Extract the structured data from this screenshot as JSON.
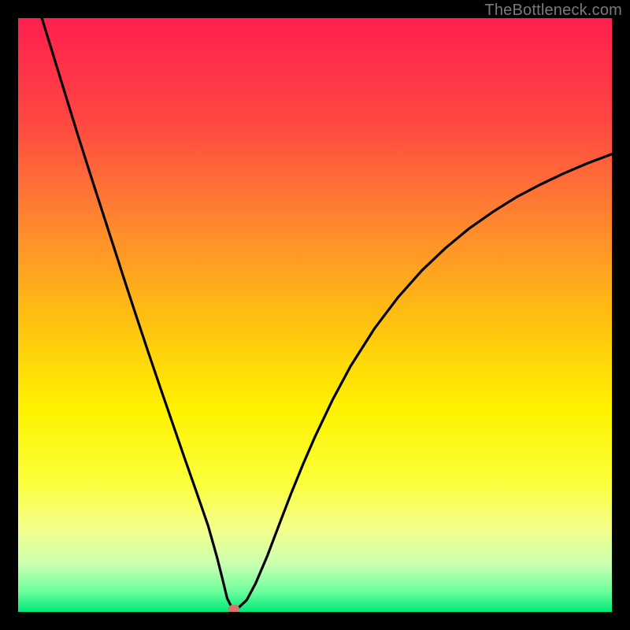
{
  "watermark": "TheBottleneck.com",
  "chart_data": {
    "type": "line",
    "title": "",
    "xlabel": "",
    "ylabel": "",
    "xlim": [
      0,
      100
    ],
    "ylim": [
      0,
      100
    ],
    "background_gradient_stops": [
      {
        "offset": 0.0,
        "color": "#ff1f4e"
      },
      {
        "offset": 0.17,
        "color": "#ff4642"
      },
      {
        "offset": 0.34,
        "color": "#ff8530"
      },
      {
        "offset": 0.5,
        "color": "#ffbe12"
      },
      {
        "offset": 0.66,
        "color": "#fff200"
      },
      {
        "offset": 0.78,
        "color": "#fbff3a"
      },
      {
        "offset": 0.86,
        "color": "#f4ff8a"
      },
      {
        "offset": 0.92,
        "color": "#caffb0"
      },
      {
        "offset": 0.965,
        "color": "#6eff9e"
      },
      {
        "offset": 1.0,
        "color": "#00e879"
      }
    ],
    "series": [
      {
        "name": "bottleneck-curve",
        "x": [
          4,
          6,
          8,
          10,
          12,
          14,
          16,
          18,
          20,
          22,
          24,
          26,
          28,
          30,
          32,
          33.5,
          34.5,
          35.2,
          36,
          37,
          38.5,
          40,
          42,
          44,
          46,
          48,
          50,
          53,
          56,
          60,
          64,
          68,
          72,
          76,
          80,
          84,
          88,
          92,
          96,
          100
        ],
        "y": [
          100,
          93.5,
          87,
          80.5,
          74.2,
          68,
          61.8,
          55.6,
          49.5,
          43.5,
          37.6,
          31.8,
          26,
          20.3,
          14.5,
          9.2,
          5.2,
          2.3,
          0.7,
          0.6,
          2.0,
          4.8,
          9.5,
          14.8,
          20.0,
          24.9,
          29.5,
          35.8,
          41.4,
          47.7,
          53.0,
          57.5,
          61.3,
          64.6,
          67.4,
          69.9,
          72.0,
          73.9,
          75.6,
          77.1
        ]
      }
    ],
    "marker": {
      "x": 36.4,
      "y": 0.5,
      "color": "#d9726a"
    }
  }
}
